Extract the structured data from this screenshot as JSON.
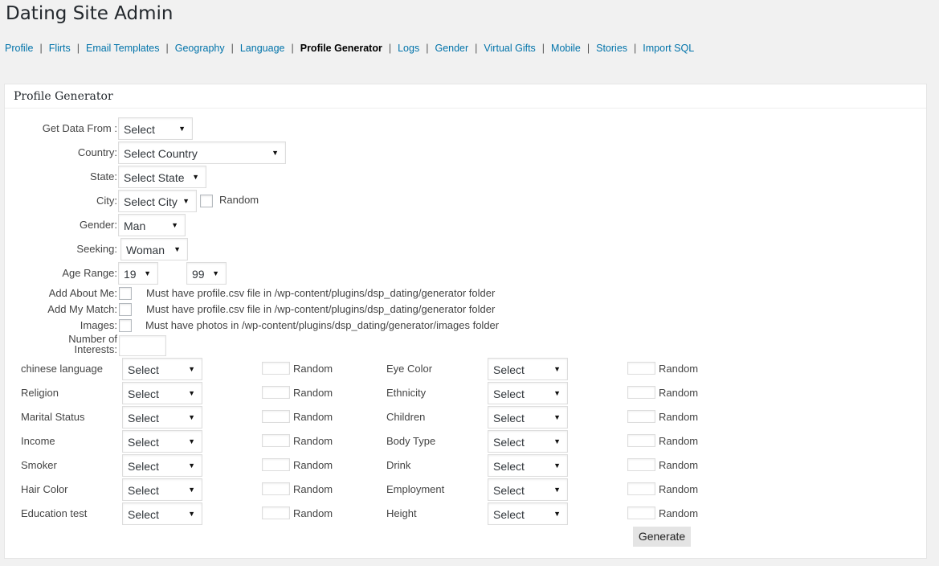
{
  "page_title": "Dating Site Admin",
  "nav": [
    {
      "label": "Profile",
      "current": false
    },
    {
      "label": "Flirts",
      "current": false
    },
    {
      "label": "Email Templates",
      "current": false
    },
    {
      "label": "Geography",
      "current": false
    },
    {
      "label": "Language",
      "current": false
    },
    {
      "label": "Profile Generator",
      "current": true
    },
    {
      "label": "Logs",
      "current": false
    },
    {
      "label": "Gender",
      "current": false
    },
    {
      "label": "Virtual Gifts",
      "current": false
    },
    {
      "label": "Mobile",
      "current": false
    },
    {
      "label": "Stories",
      "current": false
    },
    {
      "label": "Import SQL",
      "current": false
    }
  ],
  "nav_separator": "|",
  "panel_title": "Profile Generator",
  "form": {
    "get_data_from": {
      "label": "Get Data From :",
      "value": "Select"
    },
    "country": {
      "label": "Country:",
      "value": "Select Country"
    },
    "state": {
      "label": "State:",
      "value": "Select State"
    },
    "city": {
      "label": "City:",
      "value": "Select City",
      "random_label": "Random"
    },
    "gender": {
      "label": "Gender:",
      "value": "Man"
    },
    "seeking": {
      "label": "Seeking:",
      "value": "Woman"
    },
    "age_range": {
      "label": "Age Range:",
      "from": "19",
      "to": "99"
    },
    "about_me": {
      "label": "Add About Me:",
      "note": "Must have profile.csv file in /wp-content/plugins/dsp_dating/generator folder"
    },
    "my_match": {
      "label": "Add My Match:",
      "note": "Must have profile.csv file in /wp-content/plugins/dsp_dating/generator folder"
    },
    "images": {
      "label": "Images:",
      "note": "Must have photos in /wp-content/plugins/dsp_dating/generator/images folder"
    },
    "interests": {
      "label_line1": "Number of",
      "label_line2": "Interests:",
      "value": ""
    }
  },
  "attributes": {
    "random_label": "Random",
    "select_value": "Select",
    "left": [
      "chinese language",
      "Religion",
      "Marital Status",
      "Income",
      "Smoker",
      "Hair Color",
      "Education test"
    ],
    "right": [
      "Eye Color",
      "Ethnicity",
      "Children",
      "Body Type",
      "Drink",
      "Employment",
      "Height"
    ]
  },
  "generate_button": "Generate",
  "icons": {
    "dropdown": "caret-down-icon"
  },
  "colors": {
    "link": "#0073aa",
    "background": "#f1f1f1",
    "panel": "#ffffff",
    "button": "#e4e4e4"
  }
}
